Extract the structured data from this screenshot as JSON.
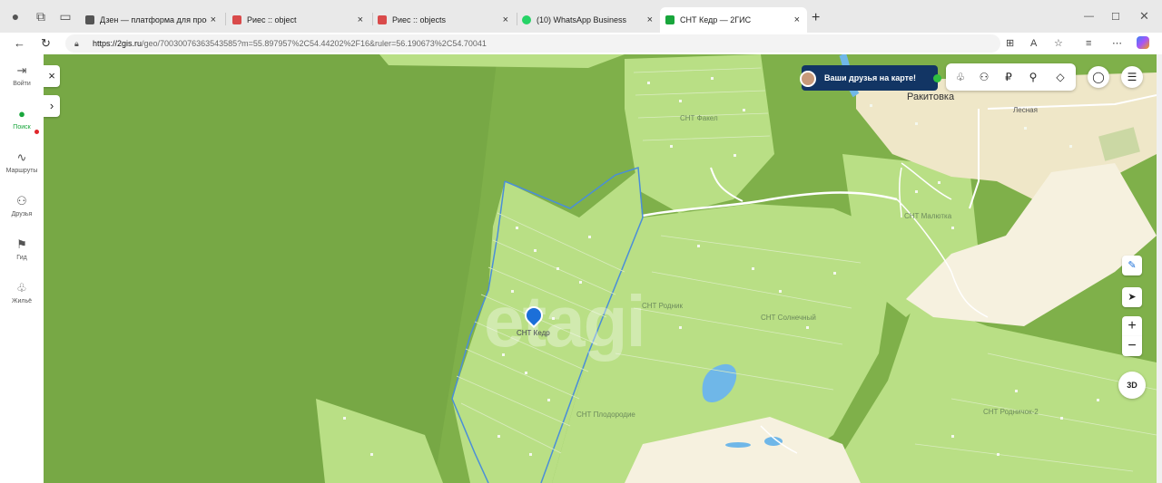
{
  "browser": {
    "tabs": [
      {
        "title": "Дзен — платформа для просмо",
        "fav_color": "#555555",
        "active": false
      },
      {
        "title": "Риес :: object",
        "fav_color": "#d94a4a",
        "active": false
      },
      {
        "title": "Риес :: objects",
        "fav_color": "#d94a4a",
        "active": false
      },
      {
        "title": "(10) WhatsApp Business",
        "fav_color": "#25d366",
        "active": false
      },
      {
        "title": "СНТ Кедр — 2ГИС",
        "fav_color": "#19a63c",
        "active": true
      }
    ],
    "new_tab_label": "+",
    "close_label": "×",
    "url_domain": "https://2gis.ru",
    "url_rest": "/geo/70030076363543585?m=55.897957%2C54.44202%2F16&ruler=56.190673%2C54.70041"
  },
  "sidebar": {
    "items": [
      {
        "label": "Войти",
        "icon": "⇥"
      },
      {
        "label": "Поиск",
        "icon": "●"
      },
      {
        "label": "Маршруты",
        "icon": "∿"
      },
      {
        "label": "Друзья",
        "icon": "⚇"
      },
      {
        "label": "Гид",
        "icon": "⚑"
      },
      {
        "label": "Жильё",
        "icon": "♧"
      }
    ]
  },
  "map": {
    "friends_banner": "Ваши друзья на карте!",
    "close_btn": "×",
    "expand_btn": "›",
    "zoom_in": "+",
    "zoom_out": "−",
    "view_3d": "3D",
    "labels": {
      "rakitovka": "Ракитовка",
      "lesnaya": "Лесная",
      "fakel": "СНТ Факел",
      "malyutka": "СНТ Малютка",
      "rodnik": "СНТ Родник",
      "solnechny": "СНТ Солнечный",
      "kedr": "СНТ Кедр",
      "plodorodie": "СНТ Плодородие",
      "rodnichok": "СНТ Родничок-2"
    },
    "watermark": "etagi",
    "colors": {
      "forest": "#7fb04a",
      "field": "#b9df85",
      "road": "#ffffff",
      "settlement": "#efe7c8",
      "water": "#6fb7e8",
      "boundary": "#4a8ed8"
    }
  }
}
